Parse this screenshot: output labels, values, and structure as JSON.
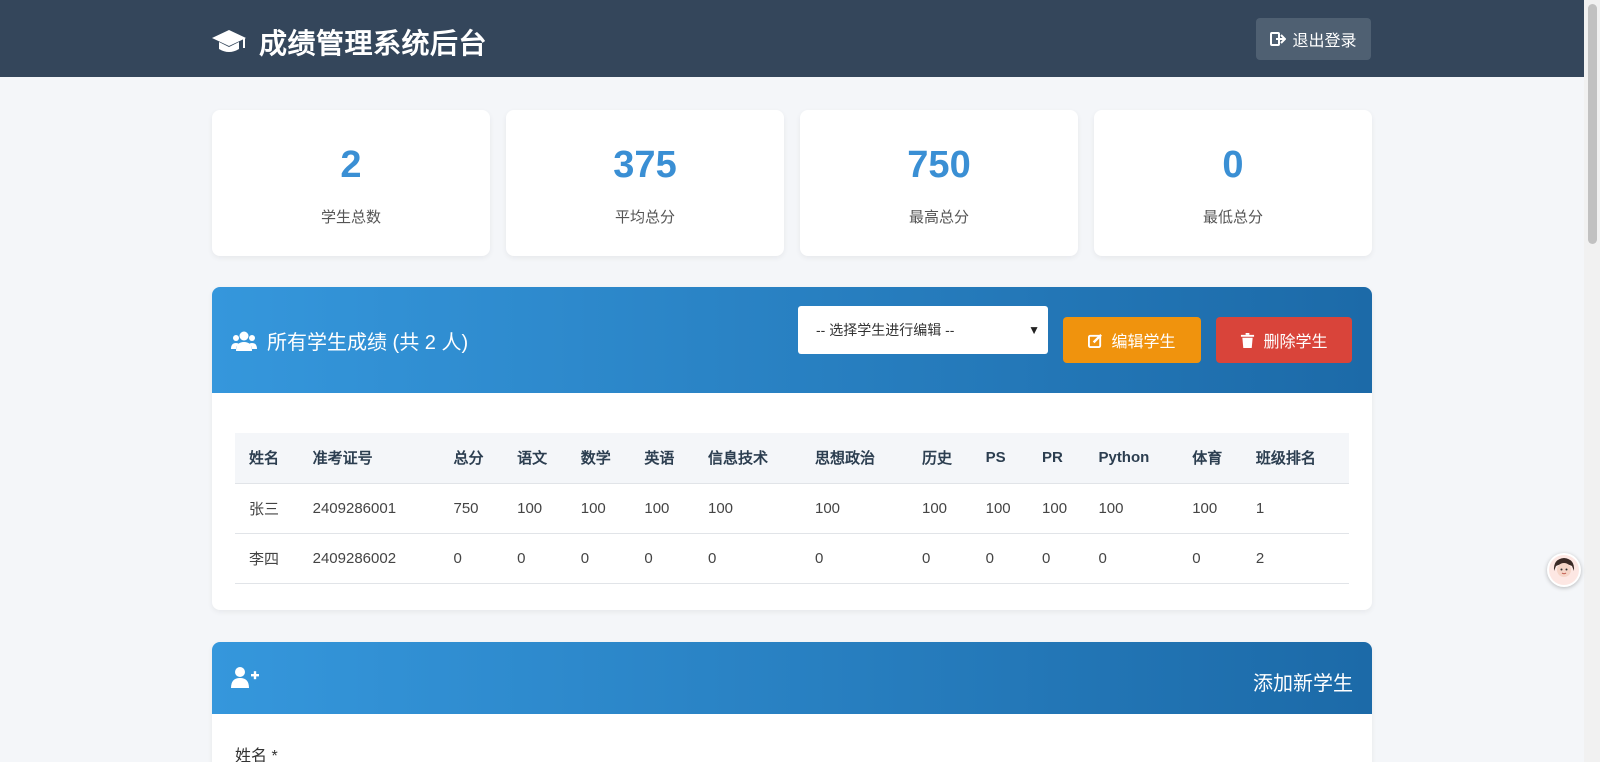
{
  "header": {
    "title": "成绩管理系统后台",
    "logout_label": "退出登录"
  },
  "stats": [
    {
      "value": "2",
      "label": "学生总数"
    },
    {
      "value": "375",
      "label": "平均总分"
    },
    {
      "value": "750",
      "label": "最高总分"
    },
    {
      "value": "0",
      "label": "最低总分"
    }
  ],
  "students_panel": {
    "title": "所有学生成绩 (共 2 人)",
    "select_placeholder": "-- 选择学生进行编辑 --",
    "edit_label": "编辑学生",
    "delete_label": "删除学生",
    "columns": [
      "姓名",
      "准考证号",
      "总分",
      "语文",
      "数学",
      "英语",
      "信息技术",
      "思想政治",
      "历史",
      "PS",
      "PR",
      "Python",
      "体育",
      "班级排名"
    ],
    "rows": [
      [
        "张三",
        "2409286001",
        "750",
        "100",
        "100",
        "100",
        "100",
        "100",
        "100",
        "100",
        "100",
        "100",
        "100",
        "1"
      ],
      [
        "李四",
        "2409286002",
        "0",
        "0",
        "0",
        "0",
        "0",
        "0",
        "0",
        "0",
        "0",
        "0",
        "0",
        "2"
      ]
    ]
  },
  "add_panel": {
    "title": "添加新学生",
    "name_label": "姓名 *"
  },
  "colors": {
    "topbar": "#34465b",
    "accent": "#3a8fd4",
    "edit": "#f0930d",
    "delete": "#d9443a"
  }
}
